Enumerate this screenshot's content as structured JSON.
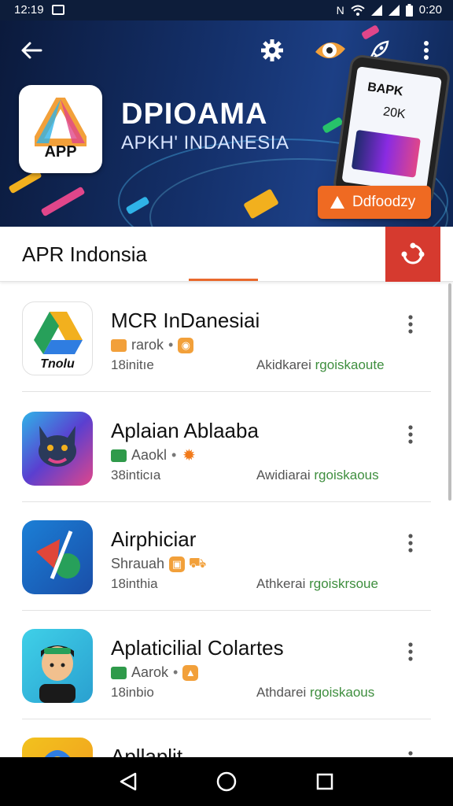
{
  "status_bar": {
    "time": "12:19",
    "clock_right": "0:20",
    "icons": [
      "image-icon",
      "nfc-icon",
      "wifi-icon",
      "signal-icon",
      "signal-icon",
      "battery-icon"
    ]
  },
  "banner": {
    "brand_title": "DPIOAMA",
    "brand_subtitle": "APKH' INDANESIA",
    "logo_text": "APP",
    "phone_line1": "BAPK",
    "phone_line2": "20K",
    "download_label": "Ddfoodzy",
    "nav_icons": [
      "back-arrow-icon",
      "gear-icon",
      "eye-icon",
      "rocket-icon",
      "more-vertical-icon"
    ]
  },
  "section": {
    "title": "APR Indonsia"
  },
  "apps": [
    {
      "name": "MCR InDanesiai",
      "logo_text": "Tnolu",
      "meta_text": "rarok",
      "size": "18initıe",
      "developer_prefix": "Akidkarei ",
      "developer_suffix": "rgoiskaoute"
    },
    {
      "name": "Aplaian Ablaaba",
      "logo_text": "",
      "meta_text": "Aaokl",
      "size": "38inticıa",
      "developer_prefix": "Awidiarai ",
      "developer_suffix": "rgoiskaous"
    },
    {
      "name": "Airphiciar",
      "logo_text": "",
      "meta_text": "Shrauah",
      "size": "18inthia",
      "developer_prefix": "Athkerai ",
      "developer_suffix": "rgoiskrsoue"
    },
    {
      "name": "Aplaticilial Colartes",
      "logo_text": "",
      "meta_text": "Aarok",
      "size": "18inbio",
      "developer_prefix": "Athdarei ",
      "developer_suffix": "rgoiskaous"
    },
    {
      "name": "Apllaplit",
      "logo_text": "",
      "meta_text": "",
      "size": "",
      "developer_prefix": "",
      "developer_suffix": ""
    }
  ],
  "colors": {
    "accent": "#ef6a22",
    "share": "#d63a2f",
    "banner_dark": "#0b1a3c"
  }
}
